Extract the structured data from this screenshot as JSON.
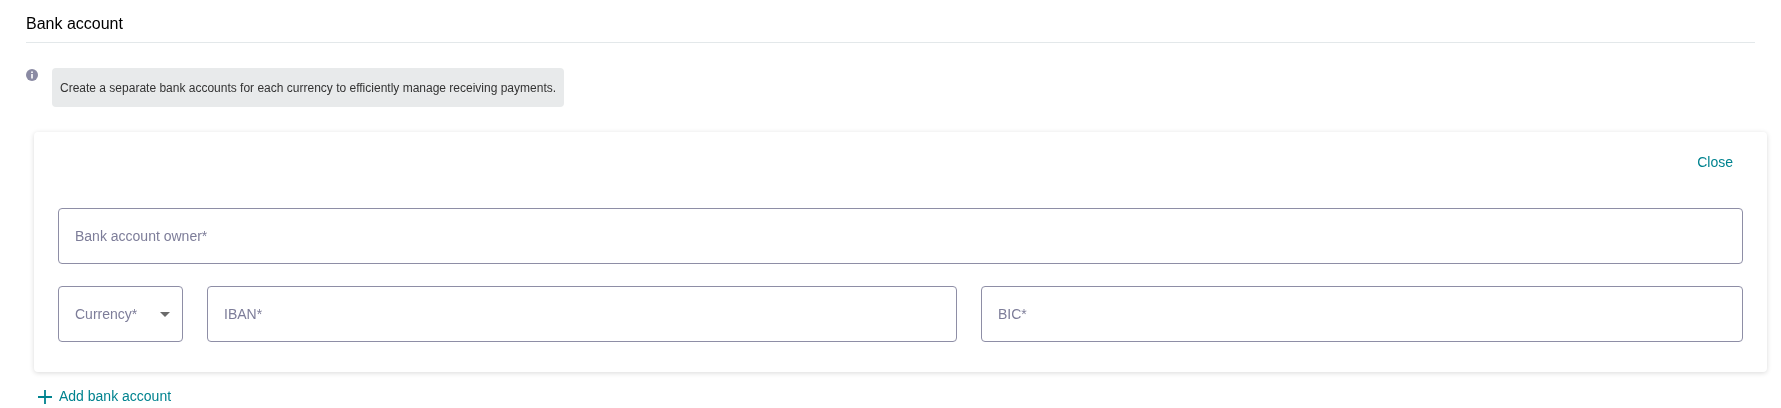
{
  "section": {
    "title": "Bank account"
  },
  "info": {
    "text": "Create a separate bank accounts for each currency to efficiently manage receiving payments."
  },
  "form": {
    "close": "Close",
    "owner": {
      "placeholder": "Bank account owner*"
    },
    "currency": {
      "placeholder": "Currency*"
    },
    "iban": {
      "placeholder": "IBAN*"
    },
    "bic": {
      "placeholder": "BIC*"
    }
  },
  "add_button": "Add bank account"
}
